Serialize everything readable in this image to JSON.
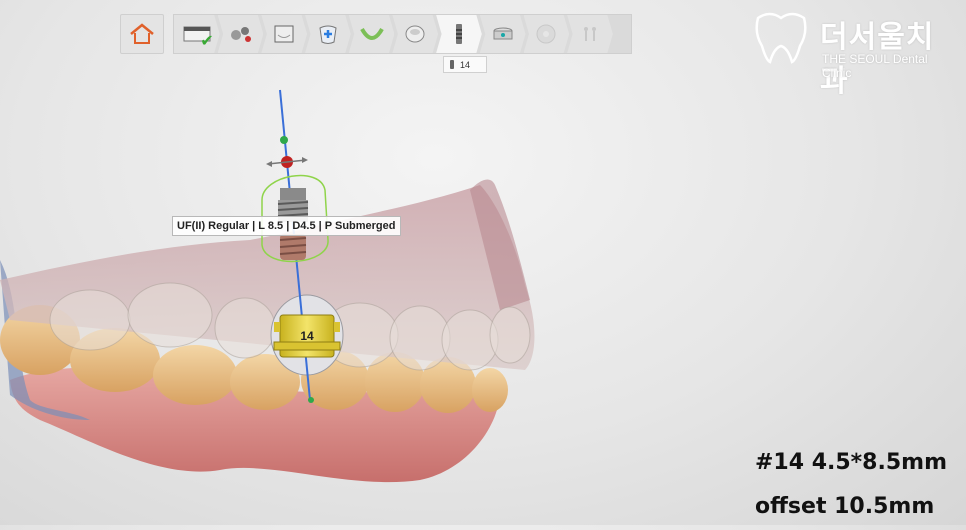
{
  "toolbar": {
    "steps": [
      {
        "icon": "scan-data-icon",
        "state": "completed"
      },
      {
        "icon": "align-tools-icon",
        "state": "normal"
      },
      {
        "icon": "model-icon",
        "state": "normal"
      },
      {
        "icon": "add-tooth-icon",
        "state": "normal"
      },
      {
        "icon": "arch-icon",
        "state": "normal"
      },
      {
        "icon": "crown-icon",
        "state": "normal"
      },
      {
        "icon": "implant-icon",
        "state": "active"
      },
      {
        "icon": "sleeve-icon",
        "state": "normal"
      },
      {
        "icon": "guide-disc-icon",
        "state": "disabled"
      },
      {
        "icon": "export-icon",
        "state": "disabled"
      }
    ],
    "tooltip_label": "14"
  },
  "logo": {
    "korean_name": "더서울치과",
    "english_name": "THE SEOUL Dental Clinic"
  },
  "scene": {
    "implant_label": "UF(II) Regular | L 8.5 | D4.5 | P Submerged",
    "site_number": "14"
  },
  "overlay": {
    "spec": "#14 4.5*8.5mm",
    "offset": "offset 10.5mm"
  },
  "colors": {
    "check": "#39a935",
    "axis": "#3a6fd8",
    "guide_outline": "#8fd44a",
    "sleeve": "#e6d23a",
    "gum": "#d98a8a",
    "tooth": "#e9c08a"
  }
}
